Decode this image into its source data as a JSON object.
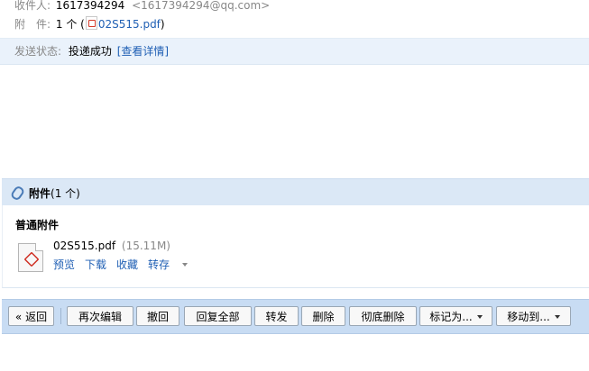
{
  "header": {
    "recipient_label": "收件人:",
    "recipient_name": "1617394294",
    "recipient_email": "<1617394294@qq.com>",
    "attachment_label": "附　件:",
    "attachment_count": "1 个",
    "attachment_open": "(",
    "attachment_file": "02S515.pdf",
    "attachment_close": ")"
  },
  "status": {
    "label": "发送状态:",
    "value": "投递成功",
    "details_link": "[查看详情]"
  },
  "attachments": {
    "title": "附件",
    "count": "(1 个)",
    "section_title": "普通附件",
    "file": {
      "name": "02S515.pdf",
      "size": "(15.11M)",
      "actions": [
        "预览",
        "下载",
        "收藏",
        "转存"
      ]
    }
  },
  "toolbar": {
    "back": "« 返回",
    "reedit": "再次编辑",
    "recall": "撤回",
    "reply_all": "回复全部",
    "forward": "转发",
    "delete": "删除",
    "delete_permanent": "彻底删除",
    "mark_as": "标记为...",
    "move_to": "移动到..."
  }
}
